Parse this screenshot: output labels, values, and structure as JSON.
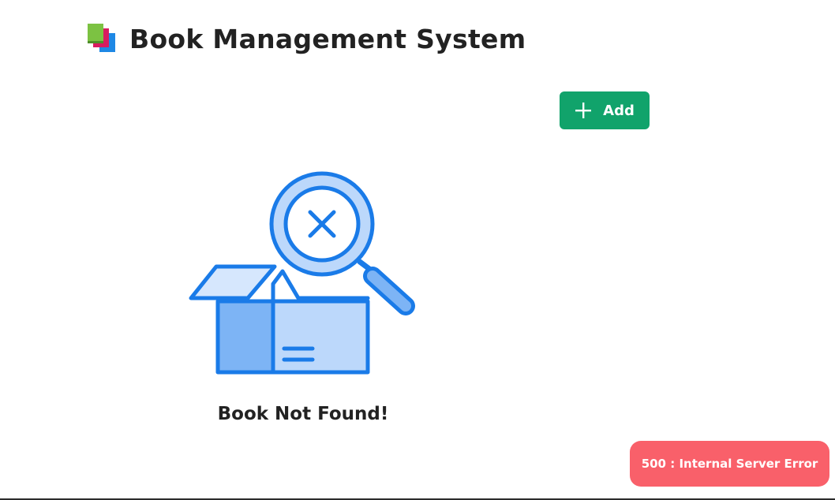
{
  "header": {
    "title": "Book Management System",
    "logo_icon": "books-icon"
  },
  "toolbar": {
    "add_label": "Add",
    "add_icon": "plus-icon",
    "add_color": "#11a36b"
  },
  "empty_state": {
    "message": "Book Not Found!",
    "illustration_icon": "box-magnifier-x-icon",
    "accent_color": "#1a7be8"
  },
  "toast": {
    "message": "500 : Internal Server Error",
    "color": "#f9606a"
  }
}
